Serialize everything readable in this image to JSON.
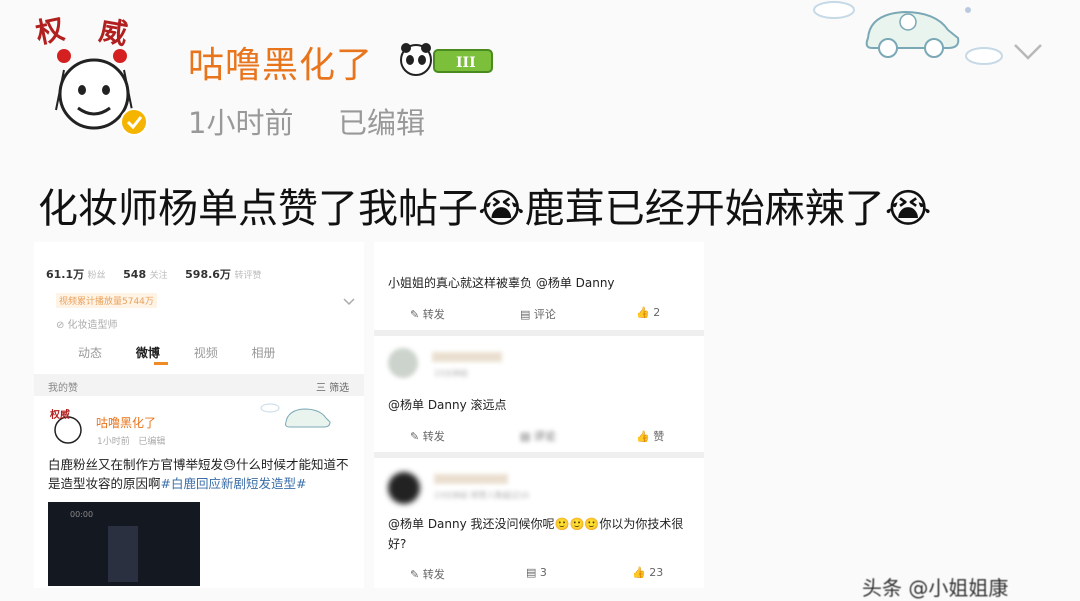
{
  "post": {
    "username": "咕噜黑化了",
    "time": "1小时前",
    "edited": "已编辑",
    "text": "化妆师杨单点赞了我帖子😭鹿茸已经开始麻辣了😭",
    "avatar_label": "权威"
  },
  "left_screenshot": {
    "stats": [
      {
        "value": "61.1万",
        "label": "粉丝"
      },
      {
        "value": "548",
        "label": "关注"
      },
      {
        "value": "598.6万",
        "label": "转评赞"
      }
    ],
    "orange_line": "视频累计播放量5744万",
    "gray_line": "⊘ 化妆造型师",
    "tabs": [
      "动态",
      "微博",
      "视频",
      "相册"
    ],
    "active_tab": "微博",
    "filter_left": "我的赞",
    "filter_right": "三 筛选",
    "mini_post": {
      "username": "咕噜黑化了",
      "time": "1小时前",
      "edited": "已编辑",
      "text_a": "白鹿粉丝又在制作方官博举短发",
      "text_b": "什么时候才能知道不是造型妆容的原因啊",
      "tag": "#白鹿回应新剧短发造型#"
    },
    "video_time": "00:00"
  },
  "right_screenshot": {
    "top_comment": "小姐姐的真心就这样被辜负 @杨单 Danny",
    "top_actions": {
      "repost": "转发",
      "comment": "评论",
      "likes": "2"
    },
    "comment2": {
      "time": "15分钟前",
      "text": "@杨单 Danny 滚远点"
    },
    "comment2_actions": {
      "repost": "转发",
      "comment": "评论",
      "likes": "赞"
    },
    "comment3": {
      "meta": "23分钟前 转赞人数超过10",
      "text": "@杨单 Danny 我还没问候你呢",
      "text2": "你以为你技术很好?"
    },
    "comment3_actions": {
      "repost": "转发",
      "comment": "3",
      "likes": "23"
    }
  },
  "watermark": "头条 @小姐姐康"
}
